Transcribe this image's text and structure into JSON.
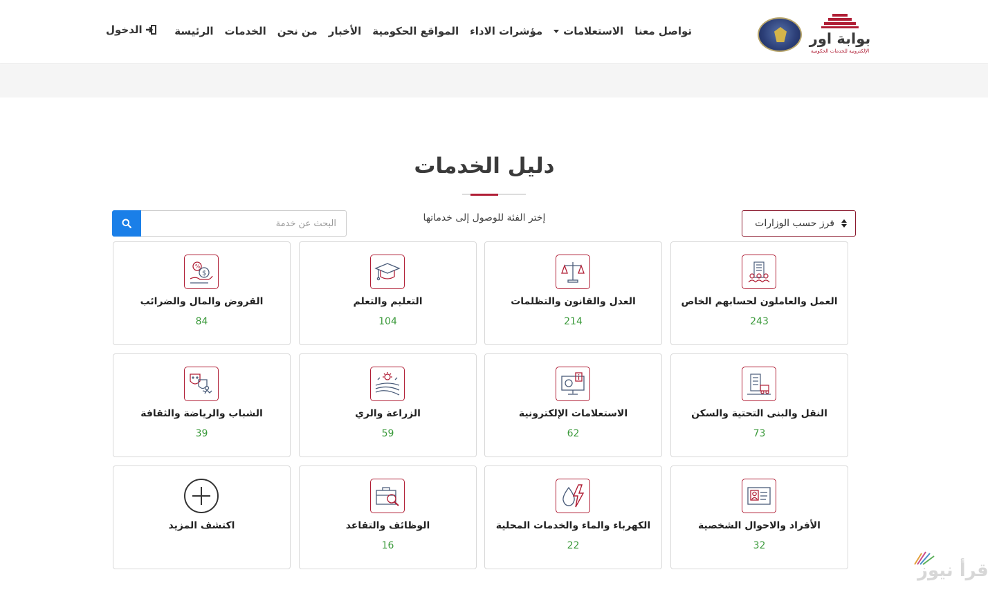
{
  "header": {
    "brand_name": "بوابة اور",
    "brand_subtitle": "الإلكترونية للخدمات الحكومية",
    "nav": [
      {
        "label": "الرئيسة"
      },
      {
        "label": "الخدمات"
      },
      {
        "label": "من نحن"
      },
      {
        "label": "الأخبار"
      },
      {
        "label": "المواقع الحكومية"
      },
      {
        "label": "مؤشرات الاداء"
      },
      {
        "label": "الاستعلامات"
      },
      {
        "label": "تواصل معنا"
      }
    ],
    "login_label": "الدخول",
    "accent_color": "#b01e35"
  },
  "main": {
    "title": "دليل الخدمات",
    "hint": "إختر الفئة للوصول إلى خدماتها",
    "sort_label": "فرز حسب الوزارات",
    "search_placeholder": "البحث عن خدمة"
  },
  "categories": [
    {
      "title": "العمل والعاملون لحسابهم الخاص",
      "count": "243",
      "icon": "workers-building-icon"
    },
    {
      "title": "العدل والقانون والتظلمات",
      "count": "214",
      "icon": "justice-scales-icon"
    },
    {
      "title": "التعليم والتعلم",
      "count": "104",
      "icon": "graduation-cap-icon"
    },
    {
      "title": "القروض والمال والضرائب",
      "count": "84",
      "icon": "money-hand-icon"
    },
    {
      "title": "النقل والبنى التحتية والسكن",
      "count": "73",
      "icon": "transport-building-icon"
    },
    {
      "title": "الاستعلامات الإلكترونية",
      "count": "62",
      "icon": "monitor-info-icon"
    },
    {
      "title": "الزراعة والري",
      "count": "59",
      "icon": "agriculture-field-icon"
    },
    {
      "title": "الشباب والرياضة والثقافة",
      "count": "39",
      "icon": "theater-masks-icon"
    },
    {
      "title": "الأفراد والاحوال الشخصية",
      "count": "32",
      "icon": "id-card-icon"
    },
    {
      "title": "الكهرباء والماء والخدمات المحلية",
      "count": "22",
      "icon": "water-electricity-icon"
    },
    {
      "title": "الوظائف والتقاعد",
      "count": "16",
      "icon": "briefcase-search-icon"
    },
    {
      "title": "اكتشف المزيد",
      "icon": "plus-circle-icon"
    }
  ],
  "watermark": "إقرأ نيوز"
}
